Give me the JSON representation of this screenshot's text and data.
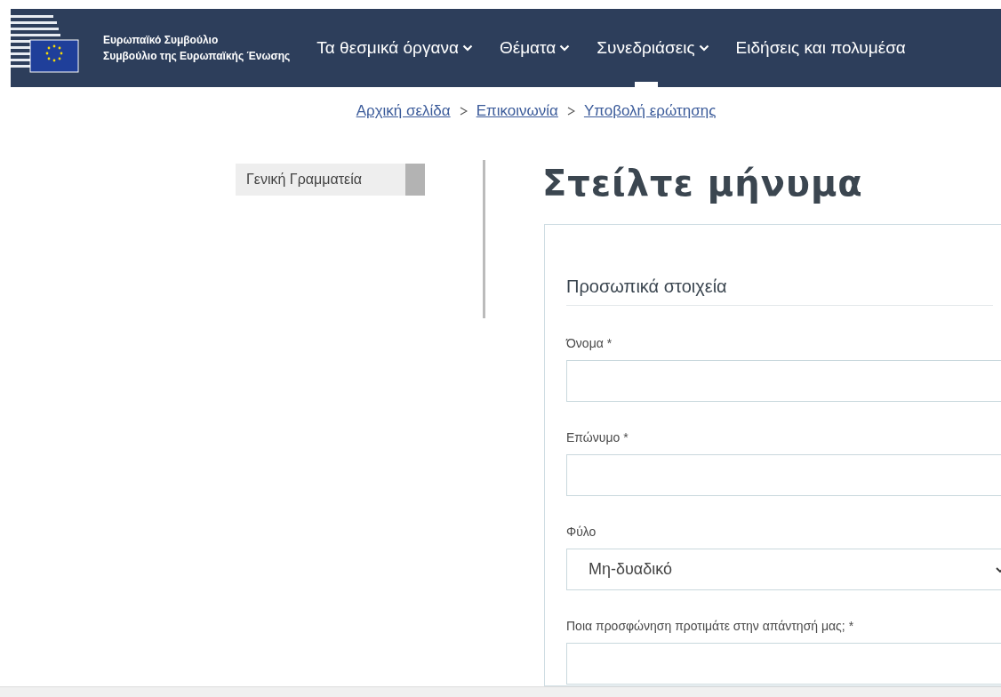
{
  "header": {
    "org_lines": [
      "Ευρωπαϊκό Συμβούλιο",
      "Συμβούλιο της Ευρωπαϊκής Ένωσης"
    ],
    "nav": [
      {
        "label": "Τα θεσμικά όργανα",
        "has_menu": true,
        "selected": false
      },
      {
        "label": "Θέματα",
        "has_menu": true,
        "selected": false
      },
      {
        "label": "Συνεδριάσεις",
        "has_menu": true,
        "selected": true
      },
      {
        "label": "Ειδήσεις και πολυμέσα",
        "has_menu": false,
        "selected": false
      }
    ]
  },
  "breadcrumb": [
    "Αρχική σελίδα",
    "Επικοινωνία",
    "Υποβολή ερώτησης"
  ],
  "sidebar": {
    "items": [
      {
        "label": "Γενική Γραμματεία",
        "selected": true
      }
    ]
  },
  "heading": "Στείλτε μήνυμα",
  "form": {
    "section_title": "Προσωπικά στοιχεία",
    "fields": [
      {
        "kind": "text",
        "label": "Όνομα *"
      },
      {
        "kind": "text",
        "label": "Επώνυμο *"
      },
      {
        "kind": "select",
        "label": "Φύλο",
        "value": "Μη-δυαδικό"
      },
      {
        "kind": "text",
        "label": "Ποια προσφώνηση προτιμάτε στην απάντησή μας; *"
      }
    ]
  }
}
